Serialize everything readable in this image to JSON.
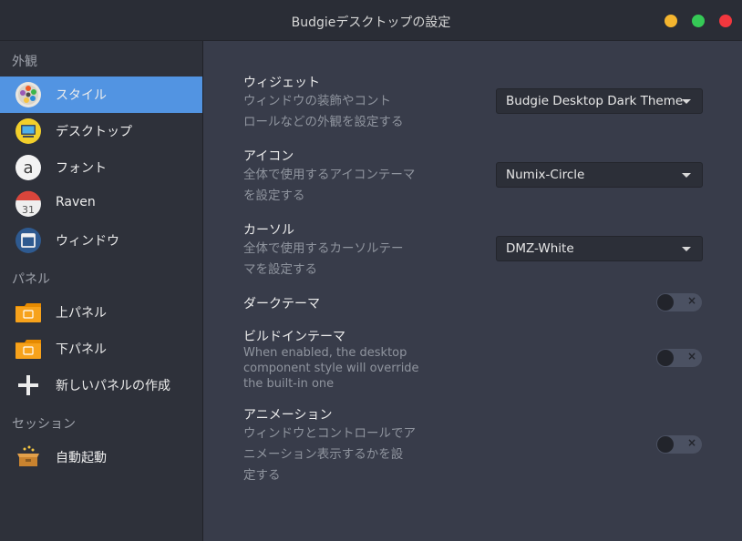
{
  "window": {
    "title": "Budgieデスクトップの設定"
  },
  "sidebar": {
    "sections": [
      {
        "label": "外観"
      },
      {
        "label": "パネル"
      },
      {
        "label": "セッション"
      }
    ],
    "items": [
      {
        "label": "スタイル",
        "icon": "style-palette-icon",
        "active": true
      },
      {
        "label": "デスクトップ",
        "icon": "desktop-icon"
      },
      {
        "label": "フォント",
        "icon": "font-icon"
      },
      {
        "label": "Raven",
        "icon": "calendar-icon"
      },
      {
        "label": "ウィンドウ",
        "icon": "window-icon"
      },
      {
        "label": "上パネル",
        "icon": "folder-panel-icon"
      },
      {
        "label": "下パネル",
        "icon": "folder-panel-icon"
      },
      {
        "label": "新しいパネルの作成",
        "icon": "plus-icon"
      },
      {
        "label": "自動起動",
        "icon": "autostart-box-icon"
      }
    ]
  },
  "options": [
    {
      "title": "ウィジェット",
      "desc": [
        "ウィンドウの装飾やコント",
        "ロールなどの外観を設定する"
      ],
      "control": "dropdown",
      "value": "Budgie Desktop Dark Theme"
    },
    {
      "title": "アイコン",
      "desc": [
        "全体で使用するアイコンテーマ",
        "を設定する"
      ],
      "control": "dropdown",
      "value": "Numix-Circle"
    },
    {
      "title": "カーソル",
      "desc": [
        "全体で使用するカーソルテー",
        "マを設定する"
      ],
      "control": "dropdown",
      "value": "DMZ-White"
    },
    {
      "title": "ダークテーマ",
      "desc": [],
      "control": "toggle",
      "on": false
    },
    {
      "title": "ビルドインテーマ",
      "desc": [
        "When enabled, the desktop",
        "component style will override",
        "the built-in one"
      ],
      "control": "toggle",
      "on": false
    },
    {
      "title": "アニメーション",
      "desc": [
        "ウィンドウとコントロールでア",
        "ニメーション表示するかを設",
        "定する"
      ],
      "control": "toggle",
      "on": false
    }
  ],
  "colors": {
    "accent": "#5294e2",
    "sidebar_bg": "#2e313a",
    "content_bg": "#383c4a",
    "btn_minimize": "#f4b52f",
    "btn_maximize": "#35c956",
    "btn_close": "#f2373e"
  }
}
